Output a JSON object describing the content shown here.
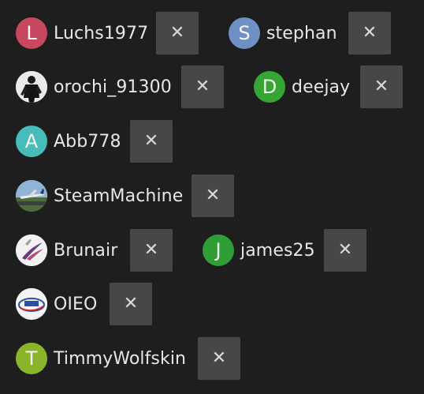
{
  "remove_glyph": "✕",
  "chips": [
    {
      "name": "Luchs1977",
      "avatar_letter": "L",
      "avatar_color": "#c6475e"
    },
    {
      "name": "stephan",
      "avatar_letter": "S",
      "avatar_color": "#6f90c4"
    },
    {
      "name": "orochi_91300",
      "avatar_icon": "photo-avatar-person-icon"
    },
    {
      "name": "deejay",
      "avatar_letter": "D",
      "avatar_color": "#37a534"
    },
    {
      "name": "Abb778",
      "avatar_letter": "A",
      "avatar_color": "#47bcb8"
    },
    {
      "name": "SteamMachine",
      "avatar_icon": "photo-avatar-airplane-icon"
    },
    {
      "name": "Brunair",
      "avatar_icon": "airline-logo-icon"
    },
    {
      "name": "james25",
      "avatar_letter": "J",
      "avatar_color": "#2f9e36"
    },
    {
      "name": "OIEO",
      "avatar_icon": "oieo-logo-icon"
    },
    {
      "name": "TimmyWolfskin",
      "avatar_letter": "T",
      "avatar_color": "#8ab52b"
    }
  ]
}
